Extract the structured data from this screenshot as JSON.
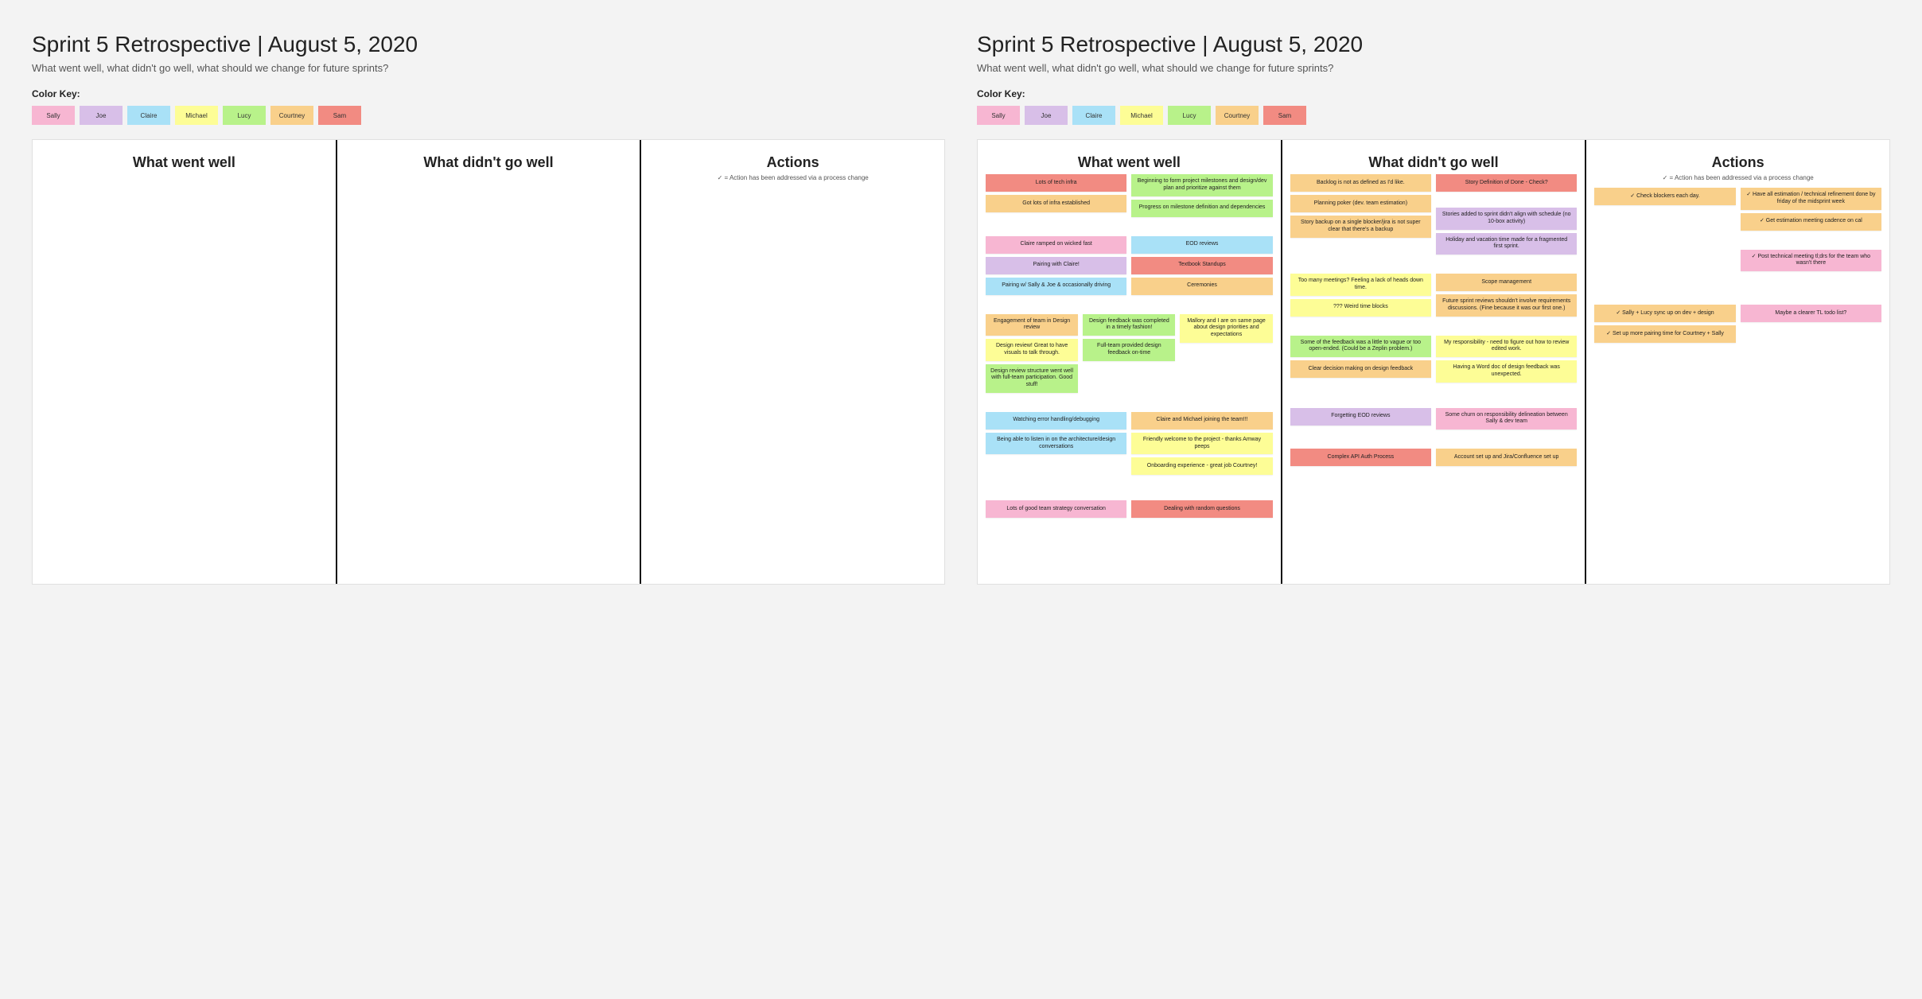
{
  "title": "Sprint 5 Retrospective  |  August 5, 2020",
  "subtitle": "What went well, what didn't go well, what should we change for future sprints?",
  "key_label": "Color Key:",
  "people": [
    {
      "name": "Sally",
      "color": "sally"
    },
    {
      "name": "Joe",
      "color": "joe"
    },
    {
      "name": "Claire",
      "color": "claire"
    },
    {
      "name": "Michael",
      "color": "michael"
    },
    {
      "name": "Lucy",
      "color": "lucy"
    },
    {
      "name": "Courtney",
      "color": "courtney"
    },
    {
      "name": "Sam",
      "color": "sam"
    }
  ],
  "col_well": "What went well",
  "col_bad": "What didn't go well",
  "col_actions": "Actions",
  "actions_sub": "✓ = Action has been addressed via a process change",
  "well": {
    "infra1": "Lots of tech infra",
    "infra2": "Got lots of infra established",
    "milestones": "Beginning to form project milestones and design/dev plan and prioritize against them",
    "progress": "Progress on milestone definition and dependencies",
    "claire_ramp": "Claire ramped on wicked fast",
    "pair_claire": "Pairing with Claire!",
    "pair_sally": "Pairing w/ Sally & Joe & occasionally driving",
    "eod": "EOD reviews",
    "textbook": "Textbook Standups",
    "ceremonies": "Ceremonies",
    "engagement": "Engagement of team in Design review",
    "design_fb": "Design feedback was completed in a timely fashion!",
    "mallory": "Mallory and I are on same page about design priorities and expectations",
    "review_vis": "Design review! Great to have visuals to talk through.",
    "fullteam_fb": "Full-team provided design feedback on-time",
    "review_struct": "Design review structure went well with full-team participation. Good stuff!",
    "cm_join": "Claire and Michael joining the team!!!",
    "watch_err": "Watching error handling/debugging",
    "listen_arch": "Being able to listen in on the architecture/design conversations",
    "welcome": "Friendly welcome to the project - thanks Amway peeps",
    "onboard": "Onboarding experience - great job Courtney!",
    "strategy": "Lots of good team strategy conversation",
    "random_q": "Dealing with random questions"
  },
  "bad": {
    "backlog": "Backlog is not as defined as I'd like.",
    "dod": "Story Definition of Done - Check?",
    "poker": "Planning poker (dev. team estimation)",
    "backup": "Story backup on a single blocker/jira is not super clear that there's a backup",
    "stories_sched": "Stories added to sprint didn't align with schedule (no 10-box activity)",
    "vacation": "Holiday and vacation time made for a fragmented first sprint.",
    "meetings": "Too many meetings? Feeling a lack of heads down time.",
    "weird_blocks": "??? Weird time blocks",
    "scope": "Scope management",
    "future_review": "Future sprint reviews shouldn't involve requirements discussions. (Fine because it was our first one.)",
    "vague_fb": "Some of the feedback was a little to vague or too open-ended. (Could be a Zeplin problem.)",
    "my_resp": "My responsibility - need to figure out how to review edited work.",
    "clear_dec": "Clear decision making on design feedback",
    "word_doc": "Having a Word doc of design feedback was unexpected.",
    "forget_eod": "Forgetting EOD reviews",
    "churn": "Some churn on responsibility delineation between Sally & dev team",
    "api_auth": "Complex API Auth Process",
    "acct": "Account set up and Jira/Confluence set up"
  },
  "actions": {
    "blockers": "✓ Check blockers each day.",
    "estimation": "✓ Have all estimation / technical refinement done by friday of the midsprint week",
    "cadence": "✓ Get estimation meeting cadence on cal",
    "tldrs": "✓ Post technical meeting tl;drs for the team who wasn't there",
    "sync": "✓ Sally + Lucy sync up on dev + design",
    "pair_time": "✓ Set up more pairing time for Courtney + Sally",
    "tl_todo": "Maybe a clearer TL todo list?"
  }
}
